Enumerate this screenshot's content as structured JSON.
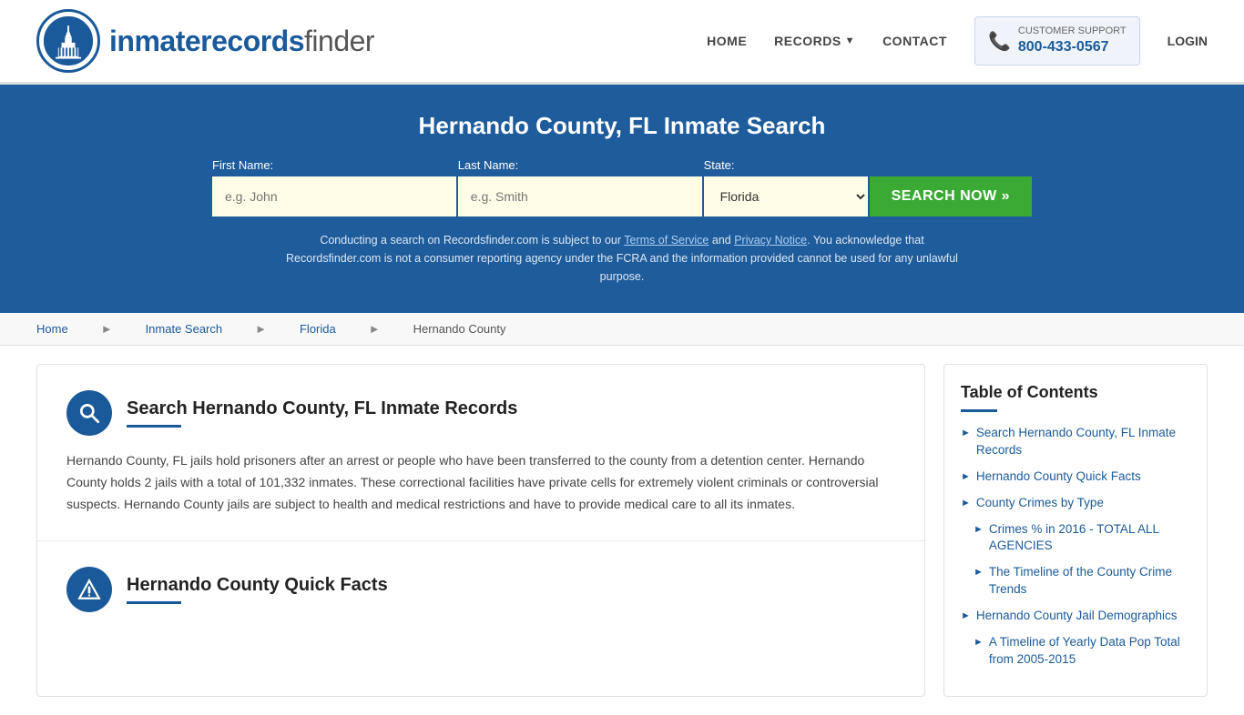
{
  "header": {
    "logo_text_main": "inmaterecords",
    "logo_text_accent": "finder",
    "nav": {
      "home": "HOME",
      "records": "RECORDS",
      "contact": "CONTACT",
      "login": "LOGIN"
    },
    "support": {
      "label": "CUSTOMER SUPPORT",
      "phone": "800-433-0567"
    }
  },
  "hero": {
    "title": "Hernando County, FL Inmate Search",
    "first_name_label": "First Name:",
    "first_name_placeholder": "e.g. John",
    "last_name_label": "Last Name:",
    "last_name_placeholder": "e.g. Smith",
    "state_label": "State:",
    "state_value": "Florida",
    "search_button": "SEARCH NOW »",
    "disclaimer": "Conducting a search on Recordsfinder.com is subject to our Terms of Service and Privacy Notice. You acknowledge that Recordsfinder.com is not a consumer reporting agency under the FCRA and the information provided cannot be used for any unlawful purpose."
  },
  "breadcrumb": {
    "items": [
      "Home",
      "Inmate Search",
      "Florida",
      "Hernando County"
    ]
  },
  "article": {
    "sections": [
      {
        "id": "section-search",
        "icon_type": "search",
        "title": "Search Hernando County, FL Inmate Records",
        "text": "Hernando County, FL jails hold prisoners after an arrest or people who have been transferred to the county from a detention center. Hernando County holds 2 jails with a total of 101,332 inmates. These correctional facilities have private cells for extremely violent criminals or controversial suspects. Hernando County jails are subject to health and medical restrictions and have to provide medical care to all its inmates."
      },
      {
        "id": "section-facts",
        "icon_type": "info",
        "title": "Hernando County Quick Facts",
        "text": ""
      }
    ]
  },
  "toc": {
    "title": "Table of Contents",
    "items": [
      {
        "label": "Search Hernando County, FL Inmate Records",
        "sub": false
      },
      {
        "label": "Hernando County Quick Facts",
        "sub": false
      },
      {
        "label": "County Crimes by Type",
        "sub": false
      },
      {
        "label": "Crimes % in 2016 - TOTAL ALL AGENCIES",
        "sub": true
      },
      {
        "label": "The Timeline of the County Crime Trends",
        "sub": true
      },
      {
        "label": "Hernando County Jail Demographics",
        "sub": false
      },
      {
        "label": "A Timeline of Yearly Data Pop Total from 2005-2015",
        "sub": true
      }
    ]
  }
}
